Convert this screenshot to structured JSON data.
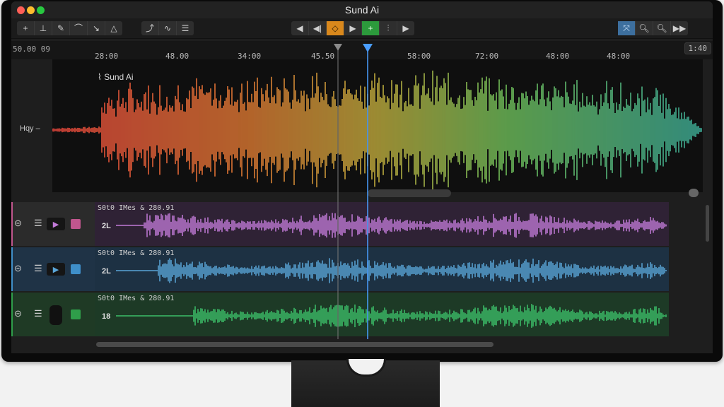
{
  "app": {
    "title": "Sund Ai"
  },
  "toolbar": {
    "left_tools": [
      {
        "icon": "add-marker-icon",
        "glyph": "+"
      },
      {
        "icon": "pin-icon",
        "glyph": "⊥"
      },
      {
        "icon": "pencil-icon",
        "glyph": "✎"
      },
      {
        "icon": "lasso-icon",
        "glyph": "⌒"
      },
      {
        "icon": "cursor-icon",
        "glyph": "↘"
      },
      {
        "icon": "fade-icon",
        "glyph": "△"
      }
    ],
    "mid_tools": [
      {
        "icon": "curve-icon",
        "glyph": "⤴"
      },
      {
        "icon": "wave-icon",
        "glyph": "∿"
      },
      {
        "icon": "list-icon",
        "glyph": "☰"
      }
    ],
    "transport": [
      {
        "icon": "rewind-icon",
        "glyph": "◀"
      },
      {
        "icon": "step-back-icon",
        "glyph": "◀|"
      },
      {
        "icon": "loop-icon",
        "glyph": "◇"
      },
      {
        "icon": "play-icon",
        "glyph": "▶"
      },
      {
        "icon": "add-track-icon",
        "glyph": "+"
      },
      {
        "icon": "mixer-icon",
        "glyph": "⫶"
      },
      {
        "icon": "forward-icon",
        "glyph": "▶"
      }
    ],
    "right_tools": [
      {
        "icon": "snap-icon",
        "glyph": "⤧"
      },
      {
        "icon": "zoom-in-icon",
        "glyph": "🔍︎"
      },
      {
        "icon": "zoom-out-icon",
        "glyph": "🔍︎"
      },
      {
        "icon": "skip-icon",
        "glyph": "▶▶"
      }
    ]
  },
  "ruler": {
    "timecode": "50.00 09",
    "labels": [
      "28:00",
      "48.00",
      "34:00",
      "45.50",
      "58:00",
      "72:00",
      "48:00",
      "48:00"
    ],
    "zoom": "1:40"
  },
  "overview": {
    "title": "Sund Ai",
    "side_label": "Hqy –"
  },
  "tracks": [
    {
      "name": "S0t0 IMes & 280.91",
      "number": "2L",
      "color": "#c27ad8",
      "accent": "#c0568d"
    },
    {
      "name": "S0t0 IMes & 280.91",
      "number": "2L",
      "color": "#5aa6d8",
      "accent": "#3f8fc9"
    },
    {
      "name": "S0t0 IMes & 280.91",
      "number": "18",
      "color": "#3cbf69",
      "accent": "#2f9e4a"
    }
  ],
  "colors": {
    "playhead": "#4a9eff",
    "locator": "#9a9a9a"
  }
}
